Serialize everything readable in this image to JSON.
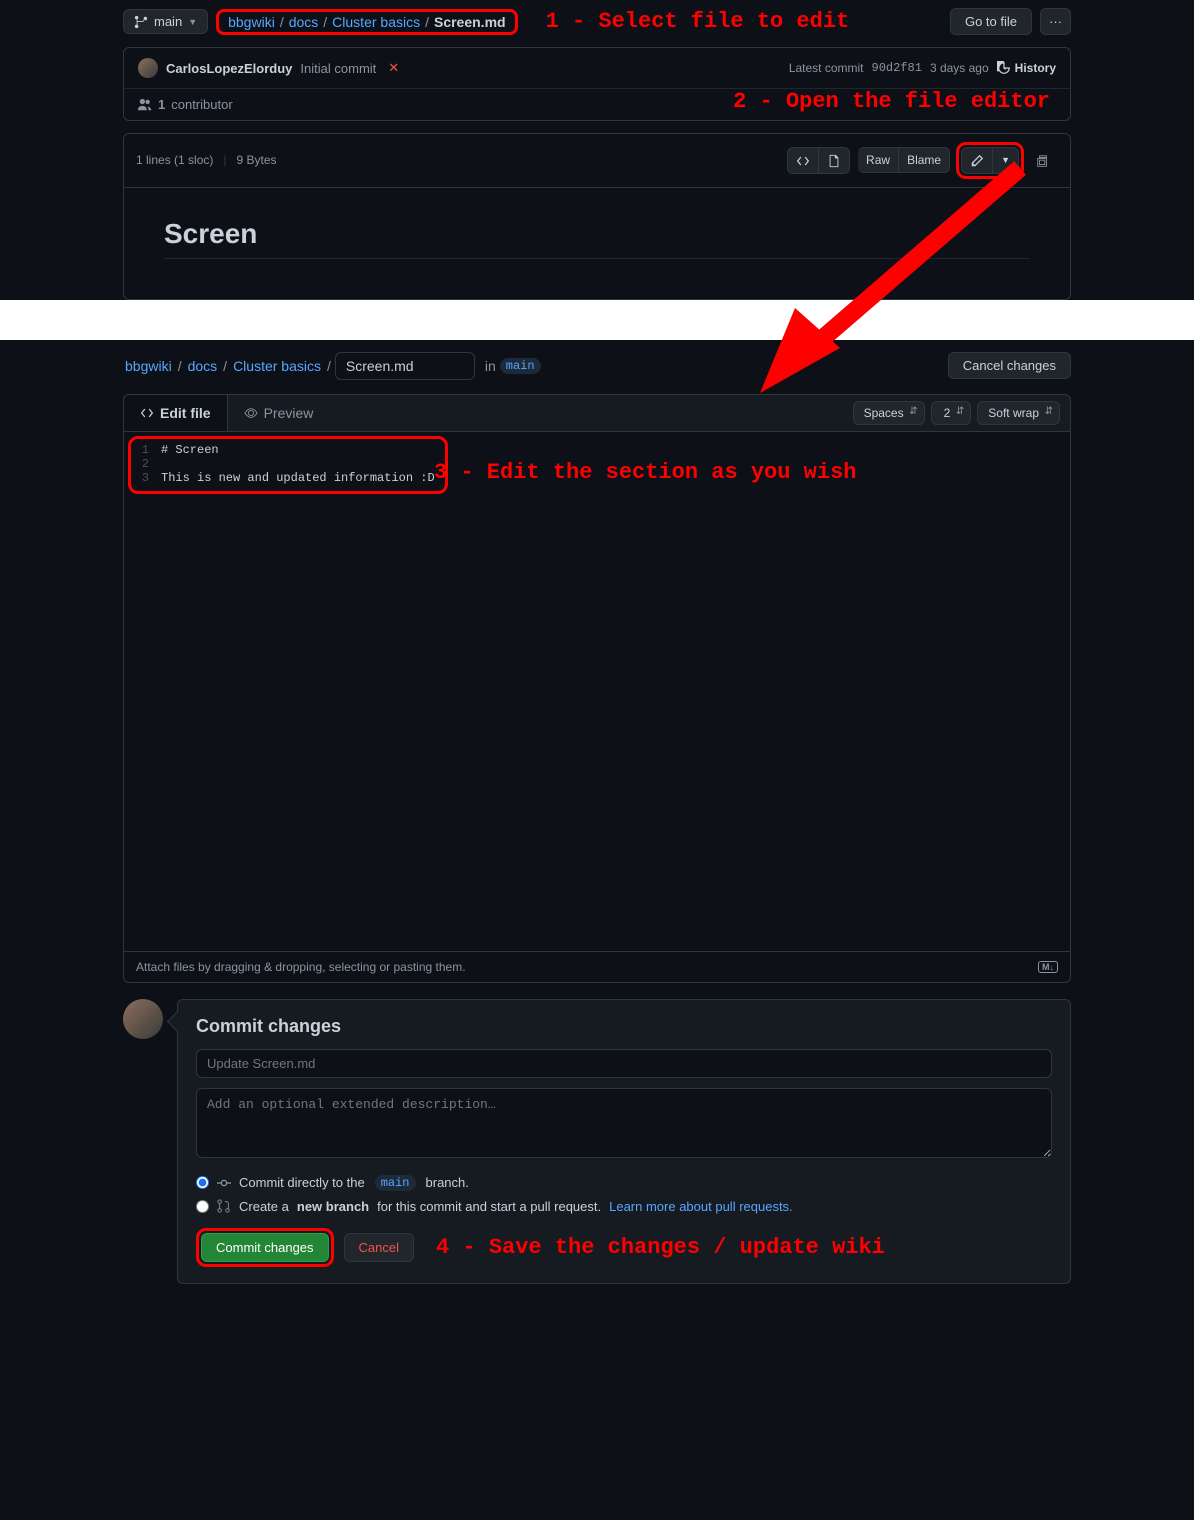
{
  "branch": "main",
  "breadcrumb": {
    "root": "bbgwiki",
    "p1": "docs",
    "p2": "Cluster basics",
    "file": "Screen.md"
  },
  "annotations": {
    "a1": "1 - Select file to edit",
    "a2": "2 - Open the file editor",
    "a3": "3 - Edit the section as you wish",
    "a4": "4 - Save the changes / update wiki"
  },
  "goToFile": "Go to file",
  "commitRow": {
    "author": "CarlosLopezElorduy",
    "message": "Initial commit",
    "latestLabel": "Latest commit",
    "sha": "90d2f81",
    "age": "3 days ago",
    "history": "History"
  },
  "contributors": {
    "count": "1",
    "label": "contributor"
  },
  "fileInfo": {
    "lines": "1 lines (1 sloc)",
    "bytes": "9 Bytes"
  },
  "viewButtons": {
    "raw": "Raw",
    "blame": "Blame"
  },
  "rendered": {
    "heading": "Screen"
  },
  "editor": {
    "cancel": "Cancel changes",
    "tabEdit": "Edit file",
    "tabPreview": "Preview",
    "spaces": "Spaces",
    "indent": "2",
    "wrap": "Soft wrap",
    "lines": [
      "# Screen",
      "",
      "This is new and updated information :D"
    ],
    "attach": "Attach files by dragging & dropping, selecting or pasting them.",
    "inLabel": "in"
  },
  "commit": {
    "title": "Commit changes",
    "summaryPlaceholder": "Update Screen.md",
    "descPlaceholder": "Add an optional extended description…",
    "directPre": "Commit directly to the",
    "directPost": "branch.",
    "branchPre": "Create a",
    "branchBold": "new branch",
    "branchPost": "for this commit and start a pull request.",
    "learnMore": "Learn more about pull requests.",
    "commitBtn": "Commit changes",
    "cancelBtn": "Cancel"
  }
}
